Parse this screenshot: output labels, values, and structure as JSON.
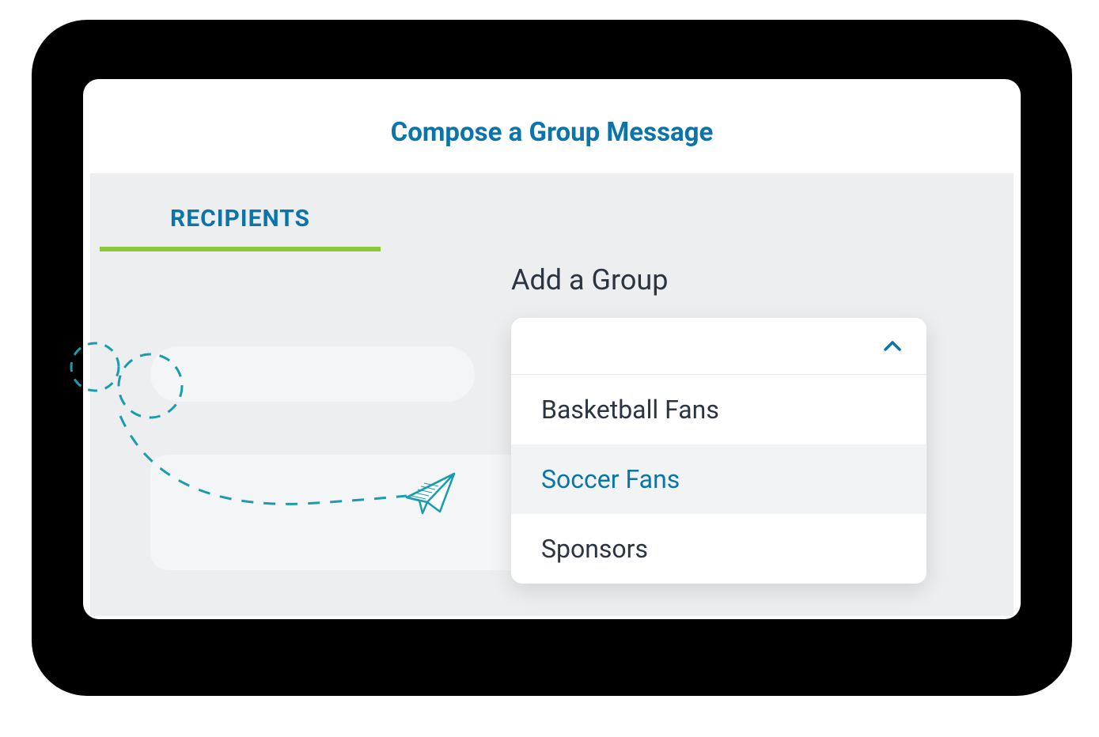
{
  "header": {
    "title": "Compose a Group Message"
  },
  "tabs": {
    "recipients_label": "RECIPIENTS"
  },
  "group_picker": {
    "section_label": "Add a Group",
    "options": [
      {
        "label": "Basketball Fans",
        "selected": false
      },
      {
        "label": "Soccer Fans",
        "selected": true
      },
      {
        "label": "Sponsors",
        "selected": false
      }
    ]
  },
  "icons": {
    "chevron": "chevron-up-icon",
    "paper_plane": "paper-airplane-icon"
  },
  "colors": {
    "brand_blue": "#0b74a8",
    "accent_green": "#8dc63f",
    "teal": "#1a9cb0",
    "text_dark": "#2b3441",
    "panel_bg": "#eceef0"
  }
}
